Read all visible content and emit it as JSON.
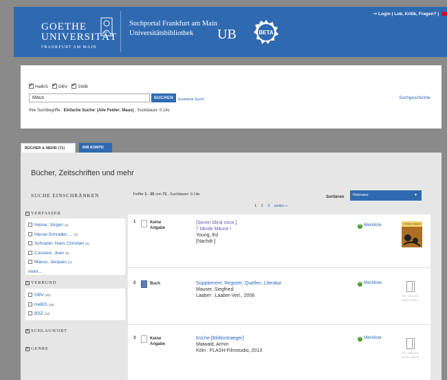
{
  "header": {
    "logo_main": "GOETHE UNIVERSITÄT",
    "logo_sub": "FRANKFURT AM MAIN",
    "portal_title_1": "Suchportal Frankfurt am Main",
    "portal_title_2": "Universitätsbibliothek",
    "ub": "UB",
    "beta_label": "BETA",
    "login": "Login",
    "feedback": "Lob, Kritik, Fragen?"
  },
  "search": {
    "sources": [
      {
        "label": "HeBIS",
        "checked": true
      },
      {
        "label": "GBV",
        "checked": true
      },
      {
        "label": "SWB",
        "checked": true
      }
    ],
    "query": "Maus",
    "button": "SUCHEN",
    "advanced": "Erweiterte Suche",
    "history": "Suchgeschichte",
    "info_prefix": "Ihre Suchbegriffe : ",
    "info_terms": "Einfache Suche: (Alle Felder: Maus)",
    "info_suffix": " , Suchdauer: 0.14s"
  },
  "tabs": {
    "books": "BÜCHER & MEHR (71)",
    "account": "IHR KONTO"
  },
  "main": {
    "title": "Bücher, Zeitschriften und mehr",
    "refine_title": "SUCHE EINSCHRÄNKEN",
    "results_prefix": "Treffer ",
    "results_range": "1 - 25",
    "results_mid": " von ",
    "results_total": "71",
    "results_suffix": " , Suchdauer: 0.14s",
    "sort_label": "Sortieren",
    "sort_value": "Relevanz",
    "pages": [
      "1",
      "2",
      "3"
    ],
    "next": "weiter »"
  },
  "facets": {
    "author_head": "VERFASSER",
    "authors": [
      {
        "name": "Hesse, Jürgen",
        "count": "(4)"
      },
      {
        "name": "Hesse-Schrader, ...",
        "count": "(4)"
      },
      {
        "name": "Schrader, Hans Christian",
        "count": "(4)"
      },
      {
        "name": "Cousteix, Jean",
        "count": "(3)"
      },
      {
        "name": "Mauss, Jacques",
        "count": "(3)"
      }
    ],
    "more": "mehr...",
    "network_head": "VERBUND",
    "networks": [
      {
        "name": "GBV",
        "count": "(40)"
      },
      {
        "name": "HeBIS",
        "count": "(19)"
      },
      {
        "name": "BSZ",
        "count": "(12)"
      }
    ],
    "subject_head": "SCHLAGWORT",
    "genre_head": "GENRE"
  },
  "results": [
    {
      "num": "1",
      "type": "Keine Angabe",
      "title": "[Seven blind mice.]",
      "title2": "7 blinde Mäuse /",
      "author": "Young, Ed",
      "extra": "[Nachdr.]",
      "save": "Merkliste",
      "cover": "7 blinde Mäuse"
    },
    {
      "num": "2",
      "type": "Buch",
      "title": "Supplement: Register, Quellen, Literatur",
      "author": "Mauser, Siegfried",
      "extra": "Laaber : Laaber-Verl., 2006",
      "save": "Merkliste",
      "noimg": "NO IMAGE AVAILABLE"
    },
    {
      "num": "3",
      "type": "Keine Angabe",
      "title": "Küche [Bildtontraeger]",
      "author": "Maiwald, Armin",
      "extra": "Köln : FLASH-Filmstudio, 2013",
      "save": "Merkliste",
      "noimg": "NO IMAGE AVAILABLE"
    }
  ]
}
